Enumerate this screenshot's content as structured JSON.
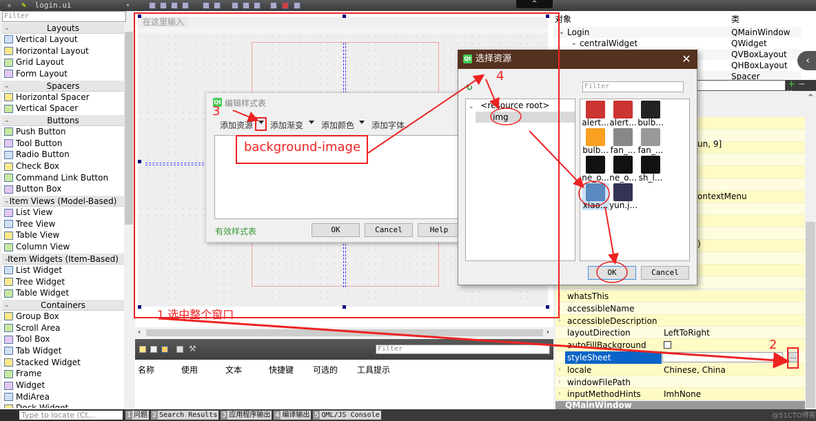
{
  "window": {
    "file_tab": "login.ui"
  },
  "widget_box": {
    "filter_placeholder": "Filter",
    "locate_placeholder": "Type to locate (Ct...",
    "sections": [
      {
        "label": "Layouts",
        "items": [
          "Vertical Layout",
          "Horizontal Layout",
          "Grid Layout",
          "Form Layout"
        ]
      },
      {
        "label": "Spacers",
        "items": [
          "Horizontal Spacer",
          "Vertical Spacer"
        ]
      },
      {
        "label": "Buttons",
        "items": [
          "Push Button",
          "Tool Button",
          "Radio Button",
          "Check Box",
          "Command Link Button",
          "Button Box"
        ]
      },
      {
        "label": "Item Views (Model-Based)",
        "items": [
          "List View",
          "Tree View",
          "Table View",
          "Column View"
        ]
      },
      {
        "label": "Item Widgets (Item-Based)",
        "items": [
          "List Widget",
          "Tree Widget",
          "Table Widget"
        ]
      },
      {
        "label": "Containers",
        "items": [
          "Group Box",
          "Scroll Area",
          "Tool Box",
          "Tab Widget",
          "Stacked Widget",
          "Frame",
          "Widget",
          "MdiArea",
          "Dock Widget"
        ]
      }
    ]
  },
  "form": {
    "lineedit_placeholder": "在这里输入"
  },
  "action_editor": {
    "filter_placeholder": "Filter",
    "columns": [
      "名称",
      "使用",
      "文本",
      "快捷键",
      "可选的",
      "工具提示"
    ]
  },
  "bottom_tabs": [
    {
      "num": "1",
      "label": "问题"
    },
    {
      "num": "2",
      "label": "Search Results"
    },
    {
      "num": "3",
      "label": "应用程序输出"
    },
    {
      "num": "4",
      "label": "编译输出"
    },
    {
      "num": "5",
      "label": "QML/JS Console"
    }
  ],
  "object_inspector": {
    "headers": [
      "对象",
      "类"
    ],
    "rows": [
      {
        "name": "Login",
        "class": "QMainWindow"
      },
      {
        "name": "centralWidget",
        "class": "QWidget"
      },
      {
        "name": "",
        "class": "QVBoxLayout"
      },
      {
        "name": "",
        "class": "QHBoxLayout"
      },
      {
        "name": "",
        "class": "Spacer"
      }
    ]
  },
  "property_editor": {
    "partial_values": [
      "un, 9]",
      "ontextMenu",
      ")"
    ],
    "rows": [
      {
        "key": "whatsThis",
        "value": ""
      },
      {
        "key": "accessibleName",
        "value": ""
      },
      {
        "key": "accessibleDescription",
        "value": ""
      },
      {
        "key": "layoutDirection",
        "value": "LeftToRight"
      },
      {
        "key": "autoFillBackground",
        "value": ""
      },
      {
        "key": "styleSheet",
        "value": ""
      },
      {
        "key": "locale",
        "value": "Chinese, China"
      },
      {
        "key": "windowFilePath",
        "value": ""
      },
      {
        "key": "inputMethodHints",
        "value": "ImhNone"
      }
    ],
    "section": "QMainWindow",
    "ellipsis": "..."
  },
  "stylesheet_dialog": {
    "title": "编辑样式表",
    "menus": [
      "添加资源",
      "添加渐变",
      "添加颜色",
      "添加字体"
    ],
    "valid_label": "有效样式表",
    "ok": "OK",
    "cancel": "Cancel",
    "help": "Help"
  },
  "resource_dialog": {
    "title": "选择资源",
    "filter_placeholder": "Filter",
    "tree_root": "<resource root>",
    "tree_child": "img",
    "icons": [
      "alert...",
      "alert...",
      "bulb...",
      "bulb...",
      "fan_...",
      "fan_...",
      "ne_o...",
      "ne_o...",
      "sh_l...",
      "xiao...",
      "yun.j..."
    ],
    "ok": "OK",
    "cancel": "Cancel"
  },
  "annotations": {
    "step1": "1 选中整个窗口",
    "step2": "2",
    "step3": "3",
    "step4": "4",
    "callout": "background-image"
  },
  "watermark": "@51CTO博客"
}
